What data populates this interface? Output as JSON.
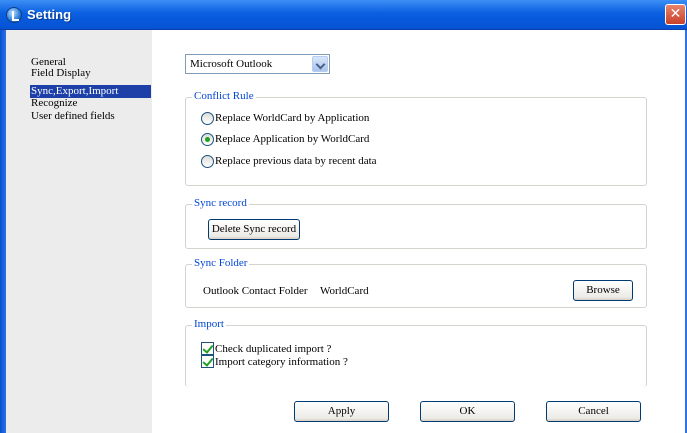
{
  "window": {
    "title": "Setting",
    "close_glyph": "✕"
  },
  "sidebar": {
    "items": [
      {
        "label": "General"
      },
      {
        "label": "Field Display"
      },
      {
        "label": "Sync,Export,Import",
        "active": true
      },
      {
        "label": "Recognize"
      },
      {
        "label": "User defined fields"
      }
    ]
  },
  "app_select": {
    "value": "Microsoft Outlook"
  },
  "conflict_rule": {
    "title": "Conflict Rule",
    "options": [
      {
        "label": "Replace WorldCard by Application",
        "checked": false
      },
      {
        "label": "Replace Application by WorldCard",
        "checked": true
      },
      {
        "label": "Replace previous data by recent data",
        "checked": false
      }
    ]
  },
  "sync_record": {
    "title": "Sync record",
    "delete_button": "Delete Sync record"
  },
  "sync_folder": {
    "title": "Sync Folder",
    "label": "Outlook Contact Folder",
    "value": "WorldCard",
    "browse_button": "Browse"
  },
  "import": {
    "title": "Import",
    "checks": [
      {
        "label": "Check duplicated import ?",
        "checked": true
      },
      {
        "label": "Import category information ?",
        "checked": true
      }
    ]
  },
  "buttons": {
    "apply": "Apply",
    "ok": "OK",
    "cancel": "Cancel"
  }
}
